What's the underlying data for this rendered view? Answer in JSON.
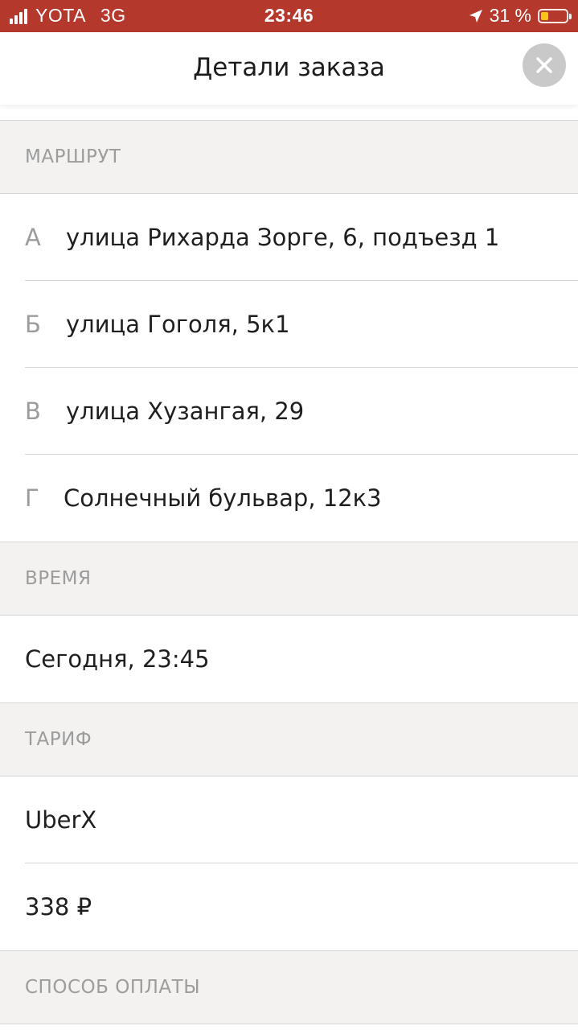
{
  "status_bar": {
    "carrier": "YOTA",
    "network": "3G",
    "time": "23:46",
    "battery_percent": "31 %",
    "battery_level": 0.31,
    "signal_icon": "signal-bars-icon",
    "location_icon": "location-arrow-icon",
    "battery_icon": "battery-icon"
  },
  "header": {
    "title": "Детали заказа",
    "close_icon": "close-icon"
  },
  "route": {
    "section_title": "МАРШРУТ",
    "stops": [
      {
        "letter": "А",
        "address": "улица Рихарда Зорге, 6, подъезд 1"
      },
      {
        "letter": "Б",
        "address": "улица Гоголя, 5к1"
      },
      {
        "letter": "В",
        "address": "улица Хузангая, 29"
      },
      {
        "letter": "Г",
        "address": "Солнечный бульвар, 12к3"
      }
    ]
  },
  "time": {
    "section_title": "ВРЕМЯ",
    "value": "Сегодня, 23:45"
  },
  "tariff": {
    "section_title": "ТАРИФ",
    "name": "UberX",
    "price": "338 ₽"
  },
  "payment": {
    "section_title": "СПОСОБ ОПЛАТЫ"
  },
  "colors": {
    "status_bar_bg": "#b5382d",
    "section_bg": "#f3f2f1",
    "muted_text": "#9c9c9c",
    "close_button_bg": "#c9c9c9",
    "battery_fill": "#f5c518"
  }
}
